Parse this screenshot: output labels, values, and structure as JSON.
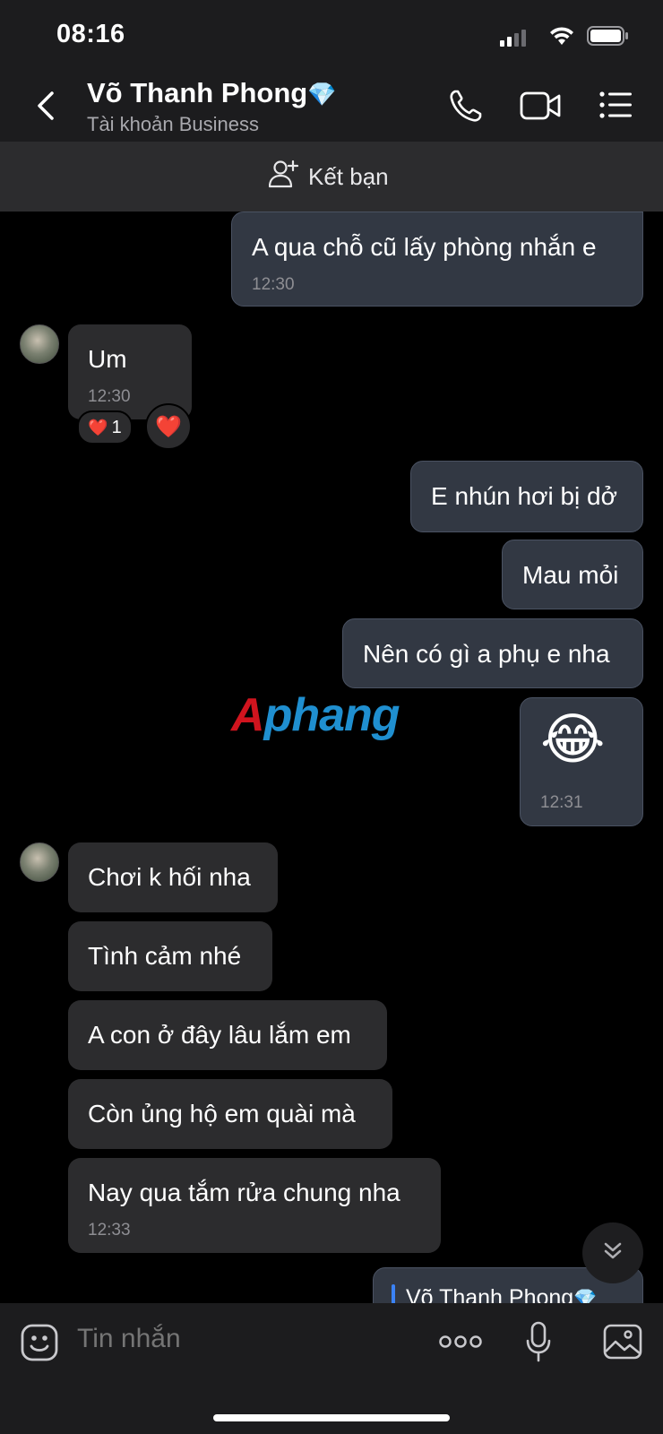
{
  "status": {
    "time": "08:16"
  },
  "header": {
    "name": "Võ Thanh Phong",
    "badge": "💎",
    "subtitle": "Tài khoản Business"
  },
  "friend_bar": {
    "label": "Kết bạn"
  },
  "messages": {
    "m1": {
      "text": "A qua chỗ cũ lấy phòng nhắn e",
      "time": "12:30"
    },
    "m2": {
      "text": "Um",
      "time": "12:30",
      "reaction_count": "1",
      "reaction": "❤️",
      "react_button": "❤️"
    },
    "m3": {
      "text": "E nhún hơi bị dở"
    },
    "m4": {
      "text": "Mau mỏi"
    },
    "m5": {
      "text": "Nên có gì a phụ e nha"
    },
    "m6": {
      "emoji": "😂",
      "time": "12:31"
    },
    "m7": {
      "text": "Chơi k hối nha"
    },
    "m8": {
      "text": "Tình cảm nhé"
    },
    "m9": {
      "text": "A con ở đây lâu lắm em"
    },
    "m10": {
      "text": "Còn ủng hộ em quài mà"
    },
    "m11": {
      "text": "Nay qua tắm rửa chung nha",
      "time": "12:33"
    },
    "m12": {
      "quote_name": "Võ Thanh Phong",
      "quote_badge": "💎"
    }
  },
  "watermark": {
    "text": "Aphang"
  },
  "composer": {
    "placeholder": "Tin nhắn"
  },
  "colors": {
    "accent": "#3b82f6",
    "outgoing_bubble": "#323843",
    "incoming_bubble": "#2c2c2e"
  }
}
